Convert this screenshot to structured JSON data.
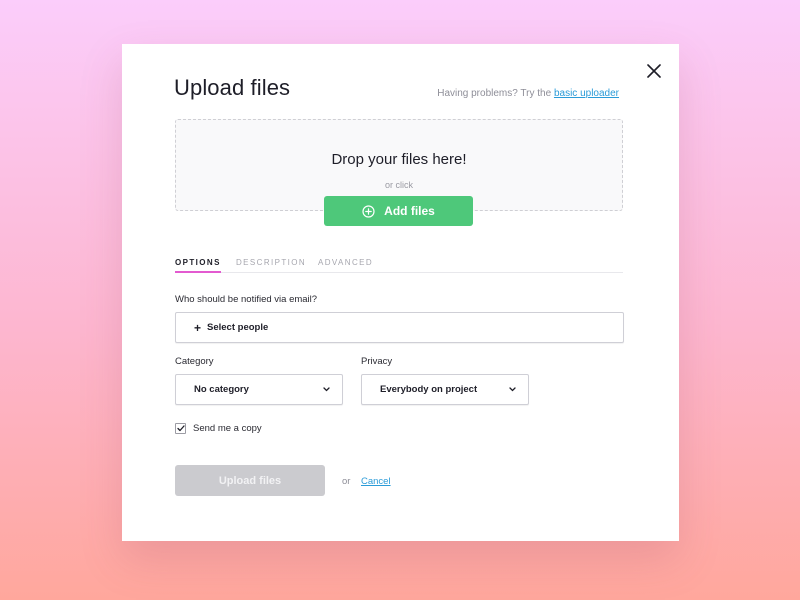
{
  "modal": {
    "title": "Upload files",
    "help_text": "Having problems? Try the",
    "help_link": "basic uploader",
    "close_icon": "close-icon"
  },
  "dropzone": {
    "title": "Drop your files here!",
    "or_click": "or click",
    "add_button": "Add files",
    "add_icon": "plus-circle-icon"
  },
  "tabs": [
    {
      "label": "OPTIONS",
      "active": true
    },
    {
      "label": "DESCRIPTION",
      "active": false
    },
    {
      "label": "ADVANCED",
      "active": false
    }
  ],
  "options": {
    "notify_label": "Who should be notified via email?",
    "select_people": "Select people",
    "category_label": "Category",
    "category_value": "No category",
    "privacy_label": "Privacy",
    "privacy_value": "Everybody on project",
    "send_copy_label": "Send me a copy",
    "send_copy_checked": true
  },
  "footer": {
    "upload_button": "Upload files",
    "or": "or",
    "cancel": "Cancel"
  },
  "colors": {
    "accent_green": "#4ec87a",
    "tab_indicator": "#e35ad0",
    "link": "#2a9bd8",
    "disabled_button": "#cbcbcf"
  }
}
